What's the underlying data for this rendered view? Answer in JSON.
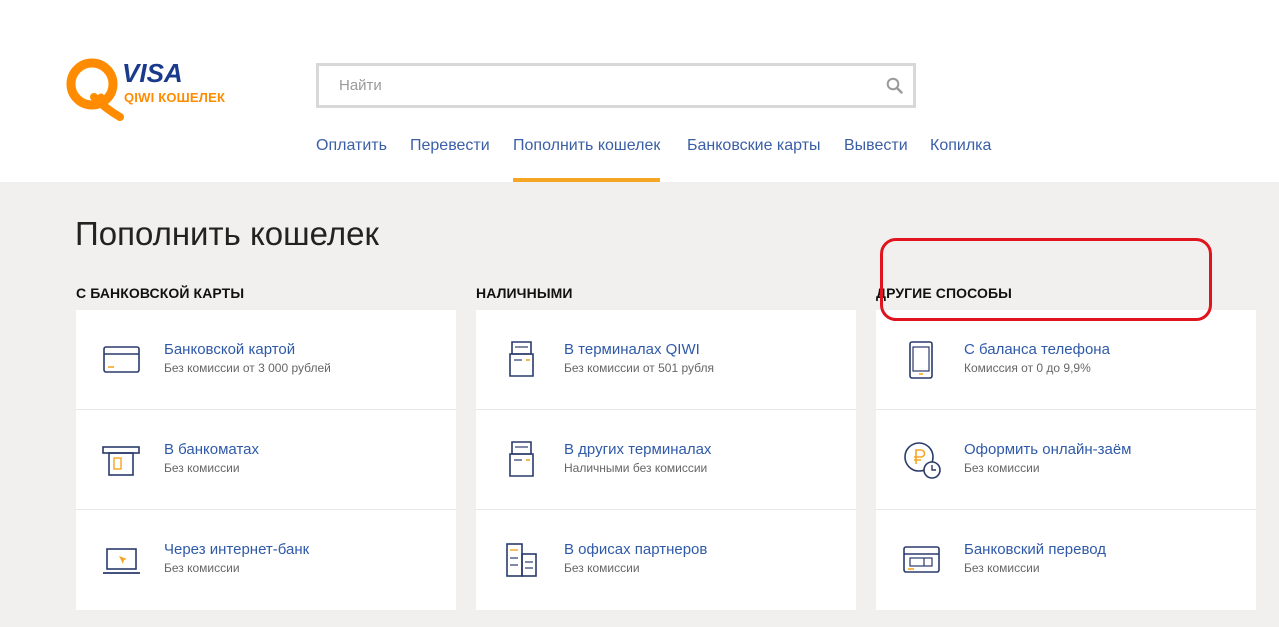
{
  "header": {
    "logo": {
      "brand_top": "VISA",
      "brand_bottom": "QIWI КОШЕЛЕК"
    },
    "search": {
      "placeholder": "Найти"
    },
    "nav": [
      {
        "label": "Оплатить"
      },
      {
        "label": "Перевести"
      },
      {
        "label": "Пополнить кошелек",
        "active": true
      },
      {
        "label": "Банковские карты"
      },
      {
        "label": "Вывести"
      },
      {
        "label": "Копилка"
      }
    ]
  },
  "main": {
    "title": "Пополнить кошелек",
    "columns": [
      {
        "heading": "С БАНКОВСКОЙ КАРТЫ",
        "items": [
          {
            "title": "Банковской картой",
            "subtitle": "Без комиссии от 3 000 рублей",
            "icon": "bank-card-icon"
          },
          {
            "title": "В банкоматах",
            "subtitle": "Без комиссии",
            "icon": "atm-icon"
          },
          {
            "title": "Через интернет-банк",
            "subtitle": "Без комиссии",
            "icon": "laptop-icon"
          }
        ]
      },
      {
        "heading": "НАЛИЧНЫМИ",
        "items": [
          {
            "title": "В терминалах QIWI",
            "subtitle": "Без комиссии от 501 рубля",
            "icon": "qiwi-terminal-icon"
          },
          {
            "title": "В других терминалах",
            "subtitle": "Наличными без комиссии",
            "icon": "terminal-icon"
          },
          {
            "title": "В офисах партнеров",
            "subtitle": "Без комиссии",
            "icon": "partner-office-icon"
          }
        ]
      },
      {
        "heading": "ДРУГИЕ СПОСОБЫ",
        "items": [
          {
            "title": "С баланса телефона",
            "subtitle": "Комиссия от 0 до 9,9%",
            "icon": "phone-icon"
          },
          {
            "title": "Оформить онлайн-заём",
            "subtitle": "Без комиссии",
            "icon": "ruble-clock-icon"
          },
          {
            "title": "Банковский перевод",
            "subtitle": "Без комиссии",
            "icon": "bank-transfer-icon"
          }
        ]
      }
    ]
  },
  "colors": {
    "link": "#2f5aa8",
    "accent": "#f5a623",
    "brand_orange": "#ff8c00",
    "brand_blue": "#1a3a8c",
    "icon_stroke": "#2a3a6b",
    "highlight": "#e0141e",
    "background": "#f1f0ee"
  }
}
